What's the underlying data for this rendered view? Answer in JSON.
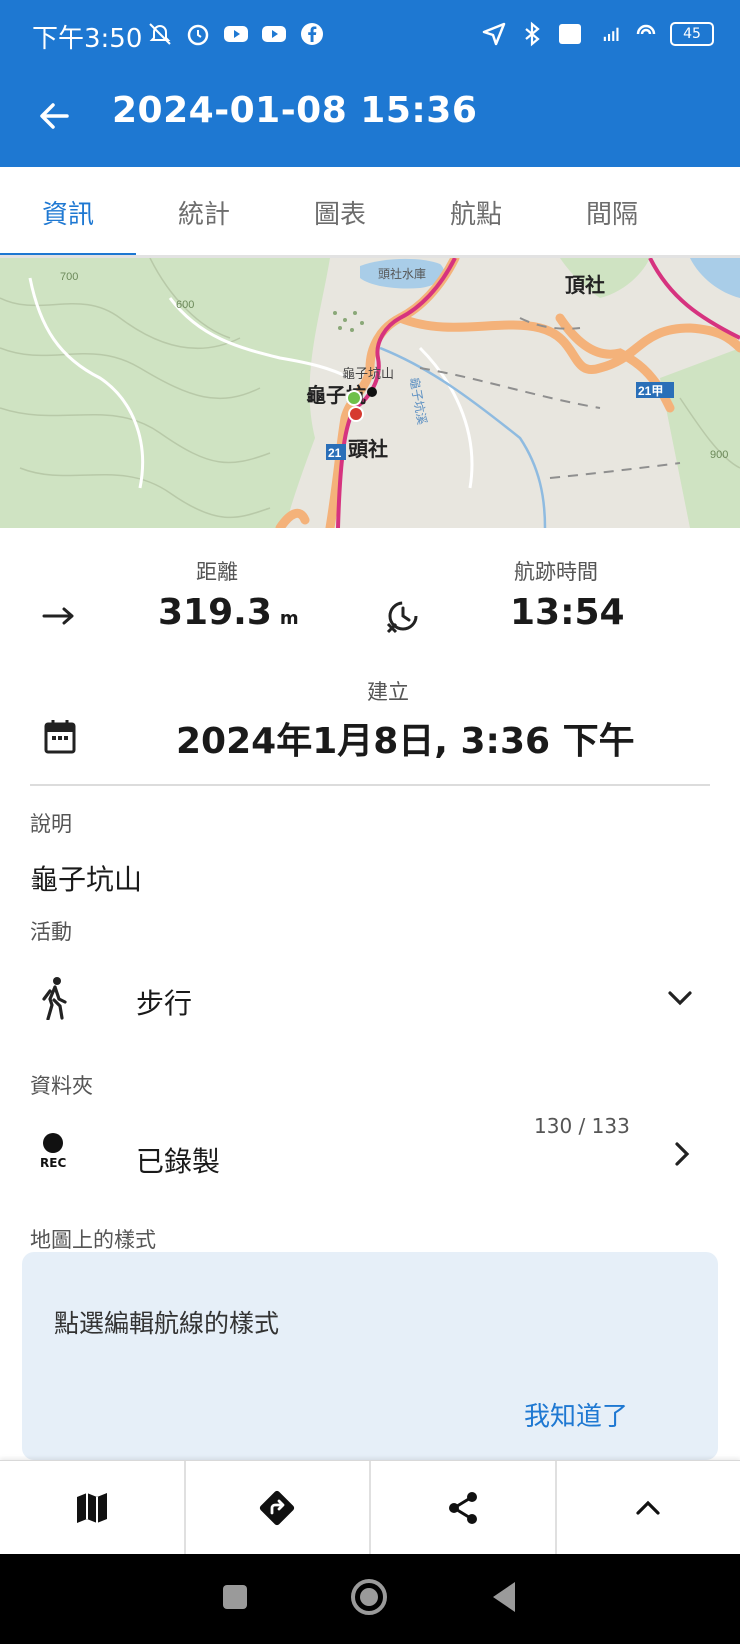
{
  "status_bar": {
    "time": "下午3:50",
    "battery": "45"
  },
  "app_bar": {
    "title": "2024-01-08 15:36"
  },
  "tabs": [
    {
      "label": "資訊",
      "active": true
    },
    {
      "label": "統計",
      "active": false
    },
    {
      "label": "圖表",
      "active": false
    },
    {
      "label": "航點",
      "active": false
    },
    {
      "label": "間隔",
      "active": false
    }
  ],
  "map": {
    "labels": {
      "town1": "頂社",
      "town2": "頭社",
      "peak": "龜子坑山",
      "peak_short": "龜子坑",
      "route_badge": "21",
      "route_badge2": "21甲",
      "river": "龜子坑溪",
      "reservoir": "頭社水庫",
      "contour1": "700",
      "contour2": "600",
      "contour3": "900"
    }
  },
  "stats": {
    "distance_label": "距離",
    "distance_value": "319.3",
    "distance_unit": "m",
    "track_time_label": "航跡時間",
    "track_time_value": "13:54",
    "created_label": "建立",
    "created_value": "2024年1月8日, 3:36 下午"
  },
  "description": {
    "label": "說明",
    "value": "龜子坑山"
  },
  "activity": {
    "label": "活動",
    "value": "步行"
  },
  "folder": {
    "label": "資料夾",
    "value": "已錄製",
    "count": "130 / 133",
    "icon_text": "REC"
  },
  "map_style": {
    "label": "地圖上的樣式"
  },
  "tooltip": {
    "text": "點選編輯航線的樣式",
    "button": "我知道了"
  },
  "colors": {
    "primary": "#1e78d2",
    "track": "#d6337f",
    "road": "#f4b27a"
  }
}
